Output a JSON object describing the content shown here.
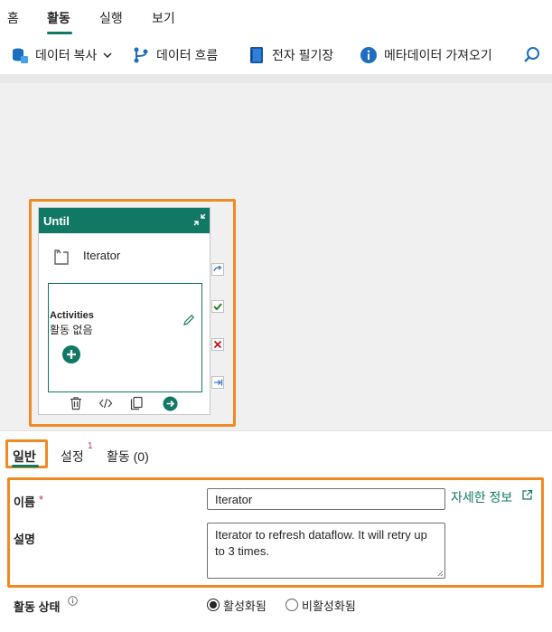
{
  "top_tabs": [
    "홈",
    "활동",
    "실행",
    "보기"
  ],
  "active_tab_index": 1,
  "ribbon": {
    "copy_data": "데이터 복사",
    "dataflow": "데이터 흐름",
    "notebook": "전자 필기장",
    "get_metadata": "메타데이터 가져오기"
  },
  "canvas": {
    "until": {
      "title": "Until",
      "iterator_label": "Iterator",
      "activities_title": "Activities",
      "activities_empty": "활동 없음"
    }
  },
  "panel": {
    "tabs": {
      "general": "일반",
      "settings": "설정",
      "settings_badge": "1",
      "activities": "활동 (0)"
    },
    "name_label": "이름",
    "required_marker": "*",
    "name_value": "Iterator",
    "learn_more": "자세한 정보",
    "description_label": "설명",
    "description_value": "Iterator to refresh dataflow. It will retry up to 3 times.",
    "activity_state_label": "활동 상태",
    "radio_active": "활성화됨",
    "radio_inactive": "비활성화됨",
    "activity_state_selected": "활성화됨"
  },
  "colors": {
    "accent": "#117865",
    "highlight": "#f08a24",
    "required": "#c4314b"
  }
}
